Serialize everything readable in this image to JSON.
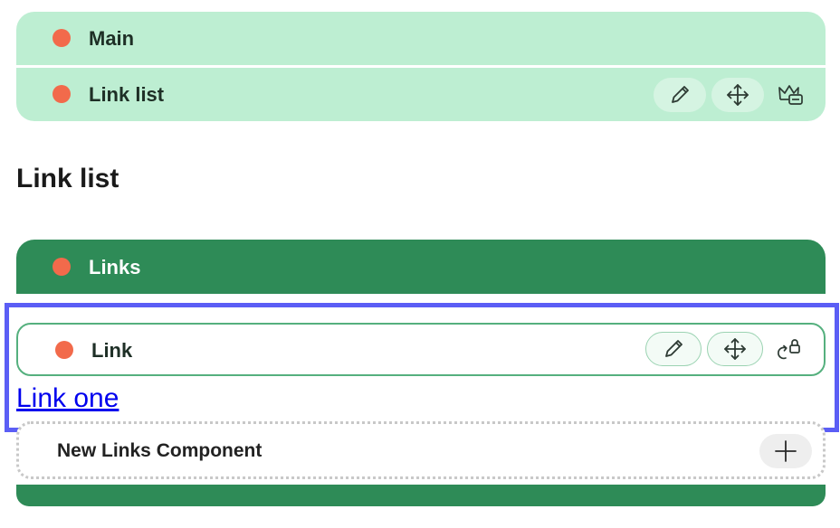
{
  "breadcrumbs": {
    "main_label": "Main",
    "list_label": "Link list"
  },
  "page": {
    "heading": "Link list"
  },
  "links_section": {
    "label": "Links",
    "link_card_label": "Link",
    "link_text": "Link one",
    "new_component_label": "New Links Component"
  },
  "icons": {
    "status_dot": "status-dot",
    "edit": "pencil-icon",
    "move": "move-arrows-icon",
    "template": "crown-template-icon",
    "unlock": "rotate-lock-icon",
    "add": "plus-icon"
  },
  "colors": {
    "breadcrumb_bg": "#bdeed2",
    "section_bg": "#2e8b57",
    "status_dot": "#f26a4b",
    "focus_outline": "#5b5ef5",
    "link": "#0000ee"
  }
}
